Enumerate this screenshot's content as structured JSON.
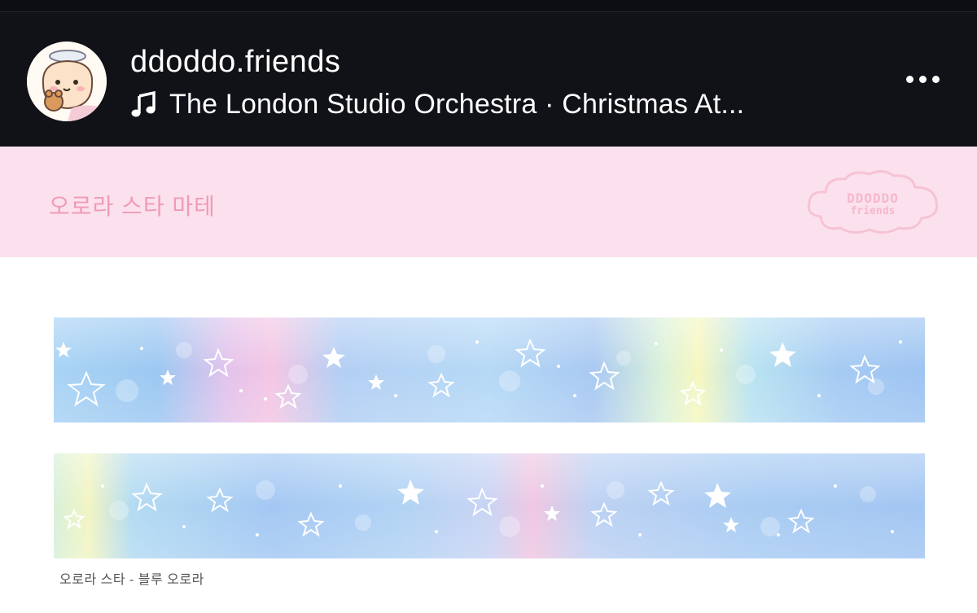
{
  "post_header": {
    "username": "ddoddo.friends",
    "music_label": "The London Studio Orchestra · Christmas At...",
    "music_icon": "music-note-icon",
    "more_icon": "more-options-icon"
  },
  "banner": {
    "title": "오로라 스타 마테",
    "brand_logo_line1": "DDODDO",
    "brand_logo_line2": "friends",
    "background_color": "#fbe1ed",
    "title_color": "#f09ab8"
  },
  "product": {
    "caption": "오로라 스타 - 블루 오로라"
  }
}
